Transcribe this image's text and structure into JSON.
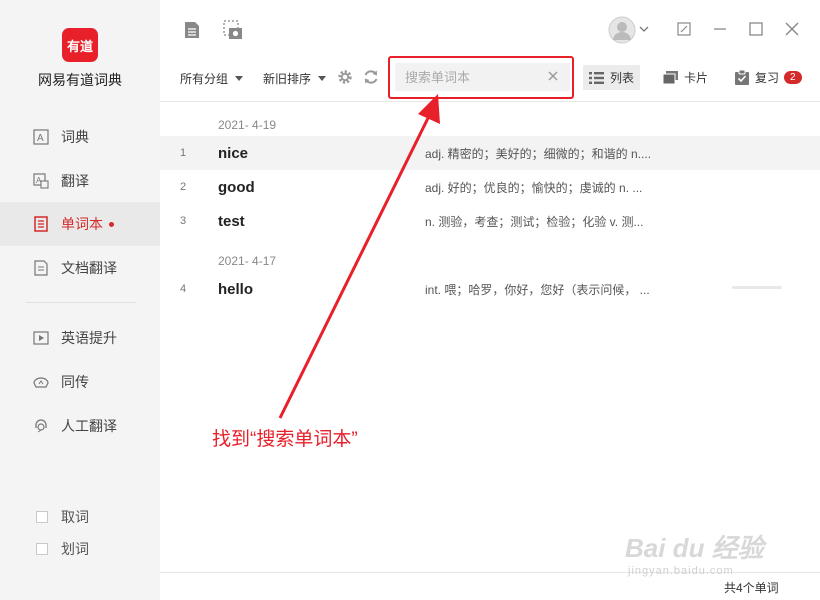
{
  "app": {
    "logo_text": "有道",
    "name": "网易有道词典"
  },
  "sidebar": {
    "items": [
      {
        "label": "词典"
      },
      {
        "label": "翻译"
      },
      {
        "label": "单词本"
      },
      {
        "label": "文档翻译"
      },
      {
        "label": "英语提升"
      },
      {
        "label": "同传"
      },
      {
        "label": "人工翻译"
      }
    ],
    "checks": [
      {
        "label": "取词"
      },
      {
        "label": "划词"
      }
    ]
  },
  "toolbar": {
    "group_label": "所有分组",
    "sort_label": "新旧排序",
    "search_placeholder": "搜索单词本",
    "list_view_label": "列表",
    "card_view_label": "卡片",
    "review_label": "复习",
    "review_count": "2"
  },
  "wordlist": {
    "groups": [
      {
        "date": "2021- 4-19",
        "rows": [
          {
            "num": "1",
            "word": "nice",
            "def": "adj. 精密的；美好的；细微的；和谐的 n...."
          },
          {
            "num": "2",
            "word": "good",
            "def": "adj. 好的；优良的；愉快的；虔诚的 n. ..."
          },
          {
            "num": "3",
            "word": "test",
            "def": "n. 测验，考查；测试；检验；化验 v. 测..."
          }
        ]
      },
      {
        "date": "2021- 4-17",
        "rows": [
          {
            "num": "4",
            "word": "hello",
            "def": "int. 喂；哈罗，你好，您好（表示问候，  ..."
          }
        ]
      }
    ]
  },
  "annotation": {
    "text": "找到“搜索单词本”"
  },
  "footer": {
    "count_label": "共4个单词"
  },
  "watermark": {
    "text": "Bai du 经验",
    "sub": "jingyan.baidu.com"
  },
  "colors": {
    "brand": "#e8202a",
    "active": "#d52a2a"
  },
  "icons": {
    "top": [
      "document-icon",
      "screenshot-icon",
      "avatar-icon"
    ],
    "window": [
      "minimize-icon",
      "maximize-icon",
      "close-icon"
    ]
  }
}
